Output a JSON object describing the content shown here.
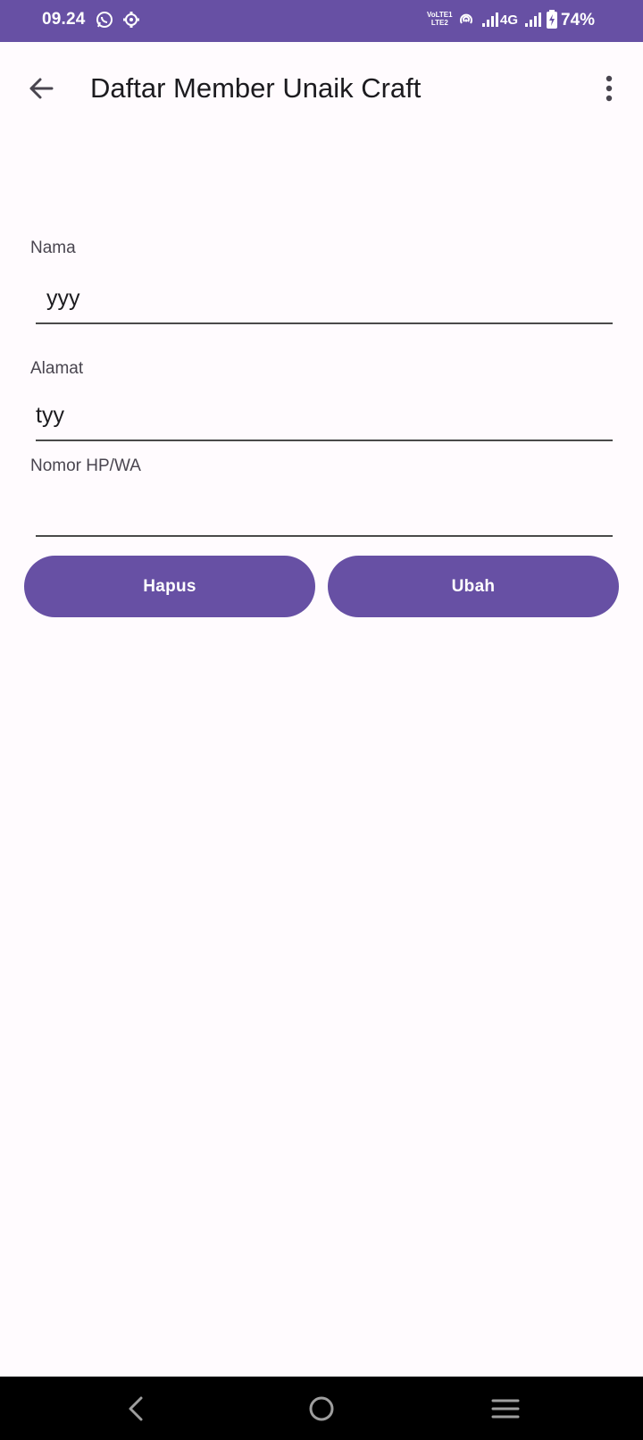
{
  "status_bar": {
    "time": "09.24",
    "volte_line1": "VoLTE1",
    "volte_line2": "LTE2",
    "network_type": "4G",
    "battery": "74%",
    "background_color": "#6750a4"
  },
  "app_bar": {
    "title": "Daftar Member Unaik Craft",
    "back_icon": "arrow-back-icon",
    "menu_icon": "more-vert-icon"
  },
  "form": {
    "nama": {
      "label": "Nama",
      "value": "yyy"
    },
    "alamat": {
      "label": "Alamat",
      "value": "tyy"
    },
    "nomor": {
      "label": "Nomor HP/WA",
      "value": ""
    }
  },
  "buttons": {
    "hapus": "Hapus",
    "ubah": "Ubah",
    "color": "#6750a4"
  },
  "nav_bar": {
    "back_icon": "nav-back-icon",
    "home_icon": "nav-home-icon",
    "menu_icon": "nav-menu-icon"
  }
}
